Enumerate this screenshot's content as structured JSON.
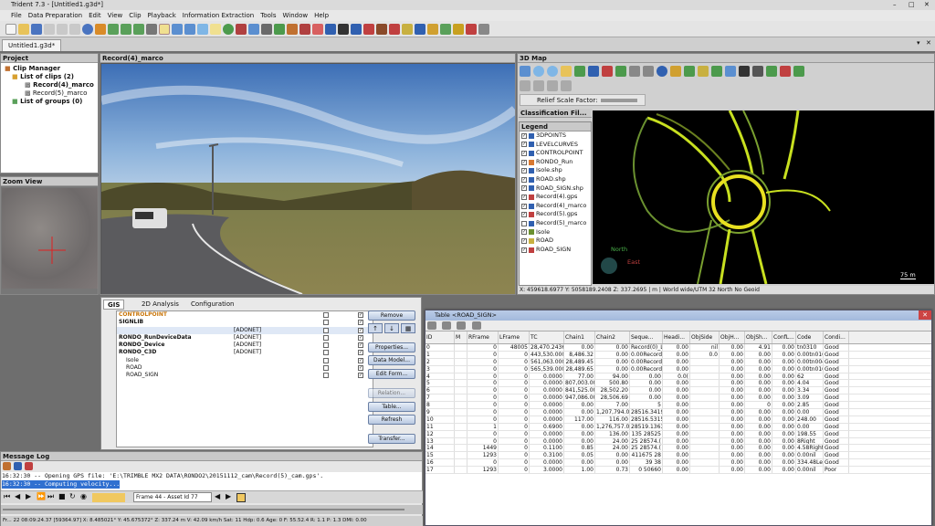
{
  "window": {
    "title": "Trident 7.3 - [Untitled1.g3d*]"
  },
  "menu": [
    "File",
    "Data Preparation",
    "Edit",
    "View",
    "Clip",
    "Playback",
    "Information Extraction",
    "Tools",
    "Window",
    "Help"
  ],
  "document_tab": "Untitled1.g3d*",
  "project": {
    "title": "Project",
    "tree": [
      "Clip Manager",
      "List of clips (2)",
      "Record(4)_marco",
      "Record(5)_marco",
      "List of groups (0)"
    ]
  },
  "zoom_view": {
    "title": "Zoom View"
  },
  "video": {
    "title": "Record(4)_marco"
  },
  "map3d": {
    "title": "3D Map",
    "relief_label": "Relief Scale Factor:",
    "classification_title": "Classification Fil...",
    "legend_title": "Legend",
    "legend": [
      "3DPOINTS",
      "LEVELCURVES",
      "CONTROLPOINT",
      "RONDO_Run",
      "Isole.shp",
      "ROAD.shp",
      "ROAD_SIGN.shp",
      "Record(4).gps",
      "Record(4)_marco",
      "Record(5).gps",
      "Record(5)_marco",
      "Isole",
      "ROAD",
      "ROAD_SIGN"
    ],
    "legend_checked": [
      true,
      true,
      true,
      true,
      true,
      true,
      true,
      true,
      true,
      true,
      false,
      true,
      true,
      true
    ],
    "north": "North",
    "east": "East",
    "scale": "75 m",
    "status": "X: 459618.6977   Y: 5058189.2408   Z: 337.2695   |   m   |   World wide/UTM 32 North No Geoid"
  },
  "gis": {
    "tabs": [
      "GIS",
      "2D Analysis",
      "Configuration"
    ],
    "layers": [
      {
        "name": "CONTROLPOINT",
        "type": "",
        "bold": true,
        "color": "#c8750a"
      },
      {
        "name": "SIGNLIB",
        "type": "",
        "bold": true,
        "color": "#111111"
      },
      {
        "name": "",
        "type": "[ADONET]",
        "bold": true,
        "color": "#d8c400"
      },
      {
        "name": "RONDO_RunDeviceData",
        "type": "[ADONET]",
        "bold": true,
        "color": "#111111"
      },
      {
        "name": "RONDO_Device",
        "type": "[ADONET]",
        "bold": true,
        "color": "#111111"
      },
      {
        "name": "RONDO_C3D",
        "type": "[ADONET]",
        "bold": true,
        "color": "#111111"
      },
      {
        "name": "Isole",
        "type": "",
        "bold": false,
        "color": "#111111"
      },
      {
        "name": "ROAD",
        "type": "",
        "bold": false,
        "color": "#111111"
      },
      {
        "name": "ROAD_SIGN",
        "type": "",
        "bold": false,
        "color": "#111111"
      }
    ],
    "buttons": [
      "Remove",
      "Properties...",
      "Data Model...",
      "Edit Form...",
      "Relation...",
      "Table...",
      "Refresh",
      "Transfer..."
    ]
  },
  "table": {
    "title": "Table <ROAD_SIGN>",
    "columns": [
      "ID",
      "M",
      "RFrame",
      "LFrame",
      "TC",
      "Chain1",
      "Chain2",
      "Seque...",
      "Headi...",
      "ObjSide",
      "ObjH...",
      "ObjSh...",
      "ConfL...",
      "Code",
      "Condi..."
    ],
    "rows": [
      [
        "0",
        "",
        "0",
        "48005",
        "28,470.2436",
        "0.00",
        "0.00",
        "Record(0)_Lo",
        "0.00",
        "nil",
        "0.00",
        "4.91",
        "0.00",
        "tn0310",
        "Good"
      ],
      [
        "1",
        "",
        "0",
        "0",
        "443,530.0000",
        "8,486.32",
        "0.00",
        "0.00Record(0)",
        "0.00",
        "0.0",
        "0.00",
        "0.00",
        "0.00",
        "0.00tn0103",
        "Good"
      ],
      [
        "2",
        "",
        "0",
        "0",
        "561,063.0000",
        "28,489.45",
        "0.00",
        "0.00Record(0)",
        "0.00",
        "",
        "0.00",
        "0.00",
        "0.00",
        "0.00tn0043",
        "Good"
      ],
      [
        "3",
        "",
        "0",
        "0",
        "565,539.0000",
        "28,489.65",
        "0.00",
        "0.00Record(0)",
        "0.00",
        "",
        "0.00",
        "0.00",
        "0.00",
        "0.00tn0105",
        "Good"
      ],
      [
        "4",
        "",
        "0",
        "0",
        "0.0000",
        "77.00",
        "94.00",
        "0.00",
        "0.0(",
        "",
        "0.00",
        "0.00",
        "0.00",
        "62",
        "Good"
      ],
      [
        "5",
        "",
        "0",
        "0",
        "0.0000",
        "807,003.00",
        "500.80",
        "0.00",
        "0.00",
        "",
        "0.00",
        "0.00",
        "0.00",
        "4.04",
        "Good"
      ],
      [
        "6",
        "",
        "0",
        "0",
        "0.0000",
        "841,525.00",
        "28,502.20",
        "0.00",
        "0.00",
        "",
        "0.00",
        "0.00",
        "0.00",
        "3.34",
        "Good"
      ],
      [
        "7",
        "",
        "0",
        "0",
        "0.0000",
        "947,086.00",
        "28,506.69",
        "0.00",
        "0.00",
        "",
        "0.00",
        "0.00",
        "0.00",
        "3.09",
        "Good"
      ],
      [
        "8",
        "",
        "0",
        "0",
        "0.0000",
        "0.00",
        "7.00",
        "5",
        "0.00",
        "",
        "0.00",
        "0",
        "0.00",
        "2.85",
        "Good"
      ],
      [
        "9",
        "",
        "0",
        "0",
        "0.0000",
        "0.00",
        "1,207,794.00",
        "28516.3419",
        "0.00",
        "",
        "0.00",
        "0.00",
        "0.00",
        "0.00",
        "Good"
      ],
      [
        "10",
        "",
        "0",
        "0",
        "0.0000",
        "117.00",
        "116.00",
        "28516.5315",
        "0.00",
        "",
        "0.00",
        "0.00",
        "0.00",
        "248.00",
        "Good"
      ],
      [
        "11",
        "",
        "1",
        "0",
        "0.6900",
        "0.00",
        "1,276,757.00",
        "28519.1363",
        "0.00",
        "",
        "0.00",
        "0.00",
        "0.00",
        "0.00",
        "Good"
      ],
      [
        "12",
        "",
        "0",
        "0",
        "0.0000",
        "0.00",
        "136.00",
        "135 28525",
        "0.00",
        "",
        "0.00",
        "0.00",
        "0.00",
        "198.55",
        "Good"
      ],
      [
        "13",
        "",
        "0",
        "0",
        "0.0000",
        "0.00",
        "24.00",
        "25 28574.(",
        "0.00",
        "",
        "0.00",
        "0.00",
        "0.00",
        "8Right",
        "Good"
      ],
      [
        "14",
        "",
        "1449",
        "0",
        "0.1100",
        "0.85",
        "24.00",
        "25 28574.(",
        "0.00",
        "",
        "0.00",
        "0.00",
        "0.00",
        "4.58Right",
        "Good"
      ],
      [
        "15",
        "",
        "1293",
        "0",
        "0.3100",
        "0.05",
        "0.00",
        "411675 28",
        "0.00",
        "",
        "0.00",
        "0.00",
        "0.00",
        "0.00nil",
        "Good"
      ],
      [
        "16",
        "",
        "0",
        "0",
        "0.0000",
        "0.00",
        "0.00",
        "39 38",
        "0.00",
        "",
        "0.00",
        "0.00",
        "0.00",
        "334.48Left",
        "Good"
      ],
      [
        "17",
        "",
        "1293",
        "0",
        "3.0000",
        "1.00",
        "0.73",
        "0 50660",
        "0.00",
        "",
        "0.00",
        "0.00",
        "0.00",
        "0.00nil",
        "Poor"
      ]
    ]
  },
  "message_log": {
    "title": "Message Log",
    "lines": [
      "16:32:30 -- Opening GPS file: 'E:\\TRIMBLE MX2 DATA\\RONDO2\\20151112_cam\\Record(5)_cam.gps'.",
      "16:32:30 -- Computing velocity..."
    ],
    "frame": "Frame 44 - Asset Id 77",
    "status": "Fr... 22   08:09:24.37   [59364.97]   X: 8.485021°   Y: 45.675372°   Z: 337.24 m   V: 42.09 km/h   Sat: 11   Hdp: 0.6   Age: 0   F: 55.52.4   R: 1.1   P: 1.3   DMI: 0.00"
  }
}
